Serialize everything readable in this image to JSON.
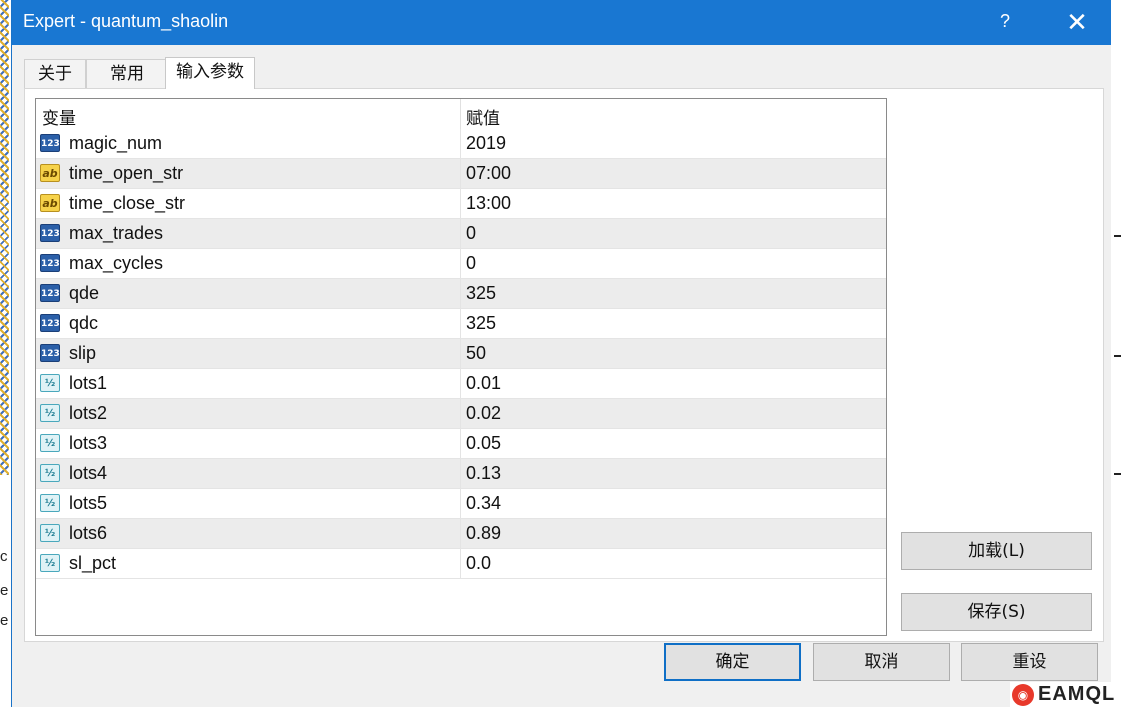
{
  "window": {
    "title": "Expert - quantum_shaolin",
    "help_label": "?",
    "close_label": "✕"
  },
  "tabs": [
    {
      "label": "关于"
    },
    {
      "label": "常用"
    },
    {
      "label": "输入参数"
    }
  ],
  "active_tab": "输入参数",
  "table": {
    "columns": [
      "变量",
      "赋值"
    ],
    "rows": [
      {
        "type": "int",
        "name": "magic_num",
        "value": "2019"
      },
      {
        "type": "string",
        "name": "time_open_str",
        "value": "07:00"
      },
      {
        "type": "string",
        "name": "time_close_str",
        "value": "13:00"
      },
      {
        "type": "int",
        "name": "max_trades",
        "value": "0"
      },
      {
        "type": "int",
        "name": "max_cycles",
        "value": "0"
      },
      {
        "type": "int",
        "name": "qde",
        "value": "325"
      },
      {
        "type": "int",
        "name": "qdc",
        "value": "325"
      },
      {
        "type": "int",
        "name": "slip",
        "value": "50"
      },
      {
        "type": "double",
        "name": "lots1",
        "value": "0.01"
      },
      {
        "type": "double",
        "name": "lots2",
        "value": "0.02"
      },
      {
        "type": "double",
        "name": "lots3",
        "value": "0.05"
      },
      {
        "type": "double",
        "name": "lots4",
        "value": "0.13"
      },
      {
        "type": "double",
        "name": "lots5",
        "value": "0.34"
      },
      {
        "type": "double",
        "name": "lots6",
        "value": "0.89"
      },
      {
        "type": "double",
        "name": "sl_pct",
        "value": "0.0"
      }
    ]
  },
  "icons": {
    "int": "123",
    "string": "ab",
    "double": "½"
  },
  "side_buttons": {
    "load": "加载(L)",
    "save": "保存(S)"
  },
  "footer_buttons": {
    "ok": "确定",
    "cancel": "取消",
    "reset": "重设"
  },
  "watermark": {
    "text": "EAMQL"
  },
  "colors": {
    "titlebar": "#1977d2",
    "accent_border": "#0f6fc6",
    "row_alt": "#ececec"
  }
}
